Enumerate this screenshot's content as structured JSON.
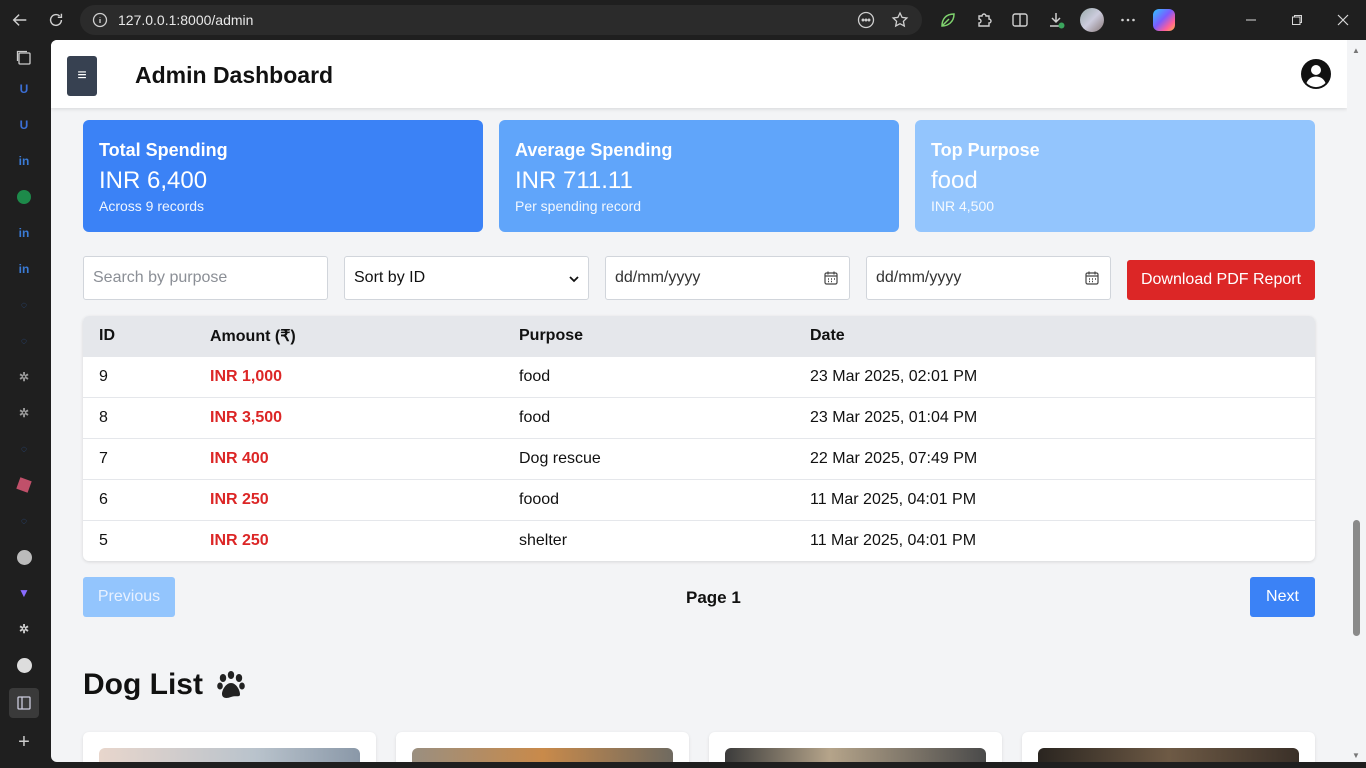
{
  "browser": {
    "url": "127.0.0.1:8000/admin"
  },
  "header": {
    "menu_glyph": "≡",
    "title": "Admin Dashboard"
  },
  "cards": [
    {
      "title": "Total Spending",
      "value": "INR 6,400",
      "sub": "Across 9 records",
      "color": "#3b82f6"
    },
    {
      "title": "Average Spending",
      "value": "INR 711.11",
      "sub": "Per spending record",
      "color": "#60a5fa"
    },
    {
      "title": "Top Purpose",
      "value": "food",
      "sub": "INR 4,500",
      "color": "#93c5fd"
    }
  ],
  "filters": {
    "search_placeholder": "Search by purpose",
    "sort_value": "Sort by ID",
    "date_from": "dd/mm/yyyy",
    "date_to": "dd/mm/yyyy",
    "pdf_button": "Download PDF Report"
  },
  "table": {
    "headers": [
      "ID",
      "Amount (₹)",
      "Purpose",
      "Date"
    ],
    "rows": [
      {
        "id": "9",
        "amount": "INR 1,000",
        "purpose": "food",
        "date": "23 Mar 2025, 02:01 PM"
      },
      {
        "id": "8",
        "amount": "INR 3,500",
        "purpose": "food",
        "date": "23 Mar 2025, 01:04 PM"
      },
      {
        "id": "7",
        "amount": "INR 400",
        "purpose": "Dog rescue",
        "date": "22 Mar 2025, 07:49 PM"
      },
      {
        "id": "6",
        "amount": "INR 250",
        "purpose": "foood",
        "date": "11 Mar 2025, 04:01 PM"
      },
      {
        "id": "5",
        "amount": "INR 250",
        "purpose": "shelter",
        "date": "11 Mar 2025, 04:01 PM"
      }
    ]
  },
  "pagination": {
    "prev": "Previous",
    "page": "Page 1",
    "next": "Next"
  },
  "dogs": {
    "title": "Dog List"
  },
  "colors": {
    "accent": "#3b82f6",
    "danger": "#dc2626",
    "dark": "#374151"
  }
}
